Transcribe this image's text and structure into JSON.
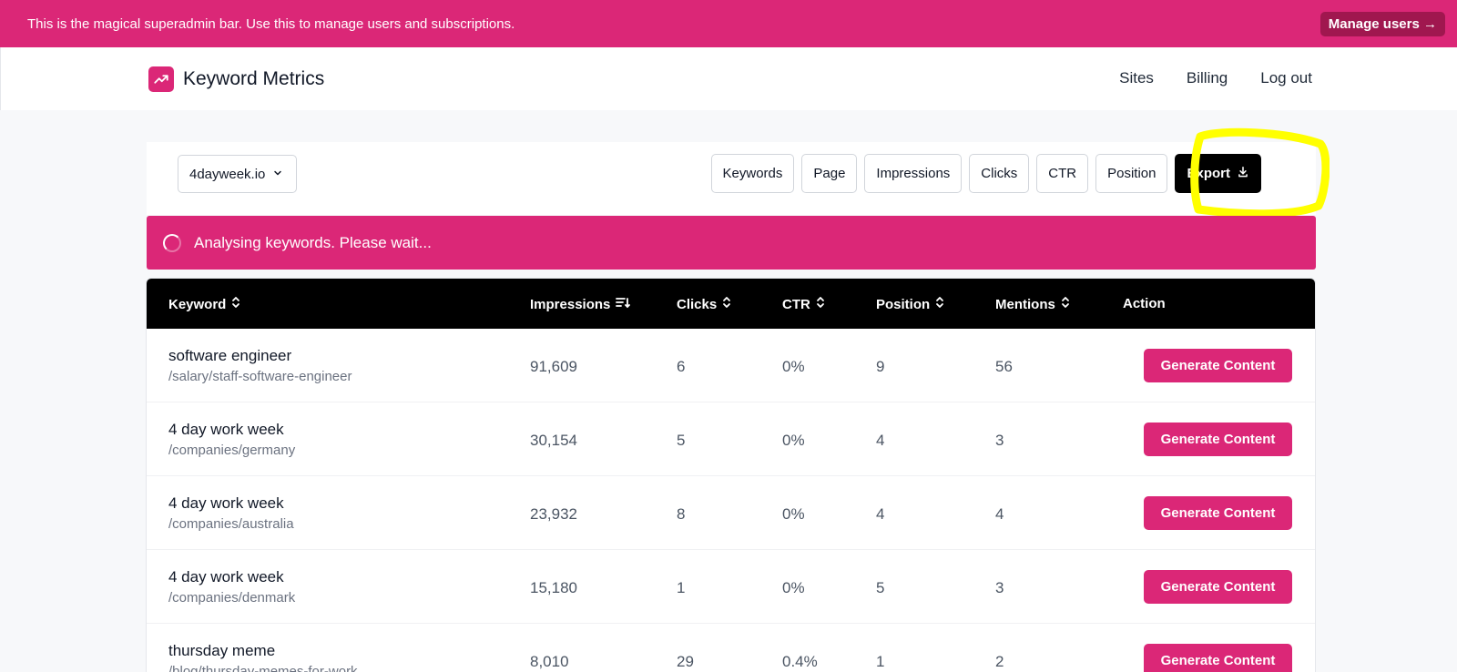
{
  "admin_bar": {
    "message": "This is the magical superadmin bar. Use this to manage users and subscriptions.",
    "manage_label": "Manage users →"
  },
  "header": {
    "app_name": "Keyword Metrics",
    "nav": [
      "Sites",
      "Billing",
      "Log out"
    ]
  },
  "toolbar": {
    "site": "4dayweek.io",
    "sort_buttons": [
      "Keywords",
      "Page",
      "Impressions",
      "Clicks",
      "CTR",
      "Position"
    ],
    "export_label": "Export"
  },
  "status": {
    "message": "Analysing keywords. Please wait..."
  },
  "table": {
    "columns": [
      "Keyword",
      "Impressions",
      "Clicks",
      "CTR",
      "Position",
      "Mentions",
      "Action"
    ],
    "action_label": "Generate Content",
    "rows": [
      {
        "keyword": "software engineer",
        "path": "/salary/staff-software-engineer",
        "impressions": "91,609",
        "clicks": "6",
        "ctr": "0%",
        "position": "9",
        "mentions": "56"
      },
      {
        "keyword": "4 day work week",
        "path": "/companies/germany",
        "impressions": "30,154",
        "clicks": "5",
        "ctr": "0%",
        "position": "4",
        "mentions": "3"
      },
      {
        "keyword": "4 day work week",
        "path": "/companies/australia",
        "impressions": "23,932",
        "clicks": "8",
        "ctr": "0%",
        "position": "4",
        "mentions": "4"
      },
      {
        "keyword": "4 day work week",
        "path": "/companies/denmark",
        "impressions": "15,180",
        "clicks": "1",
        "ctr": "0%",
        "position": "5",
        "mentions": "3"
      },
      {
        "keyword": "thursday meme",
        "path": "/blog/thursday-memes-for-work",
        "impressions": "8,010",
        "clicks": "29",
        "ctr": "0.4%",
        "position": "1",
        "mentions": "2"
      }
    ]
  },
  "colors": {
    "brand": "#db2777",
    "highlight": "#ffff00",
    "table_header": "#000000"
  }
}
